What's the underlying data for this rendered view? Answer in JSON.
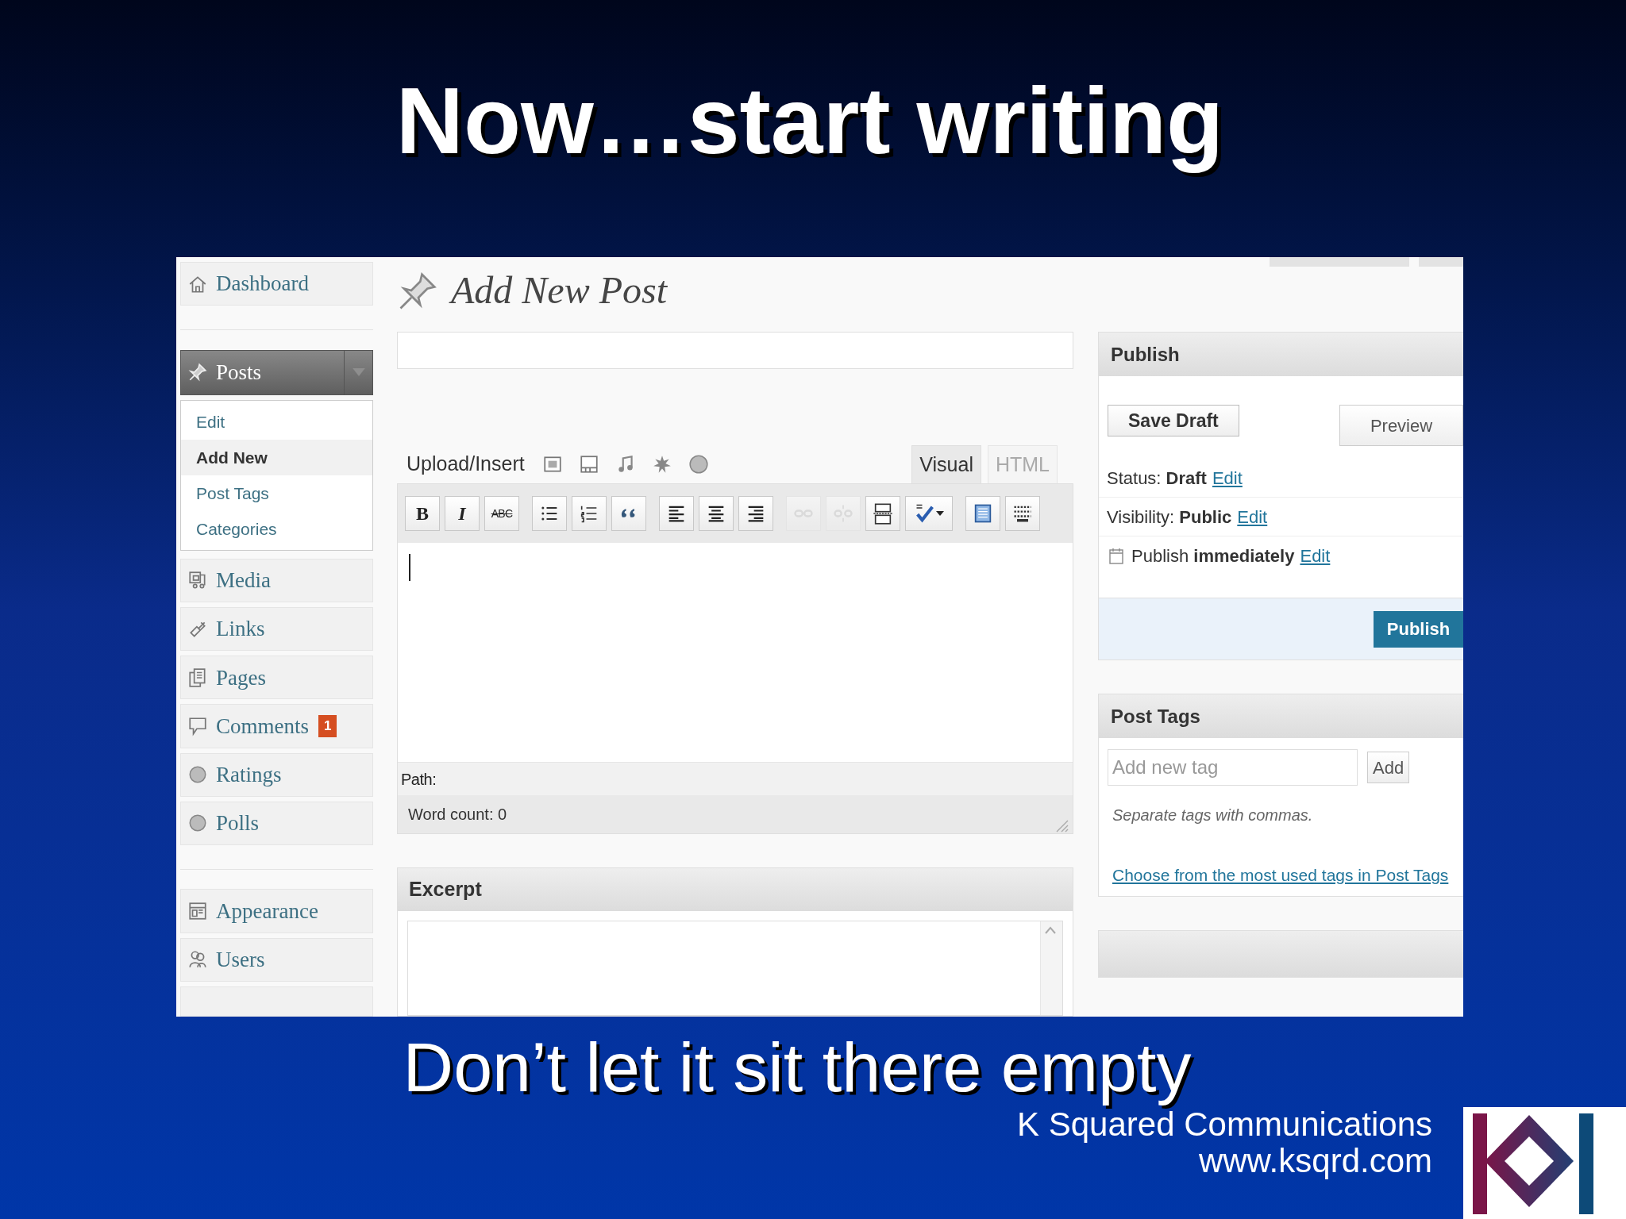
{
  "slide": {
    "title": "Now…start writing",
    "caption": "Don’t let it sit there empty",
    "company": "K Squared Communications",
    "website": "www.ksqrd.com"
  },
  "sidebar": {
    "items": [
      {
        "kind": "menu",
        "label": "Dashboard"
      },
      {
        "kind": "separator"
      },
      {
        "kind": "menu",
        "label": "Posts",
        "expanded": true,
        "children": [
          {
            "label": "Edit",
            "selected": false
          },
          {
            "label": "Add New",
            "selected": true
          },
          {
            "label": "Post Tags",
            "selected": false
          },
          {
            "label": "Categories",
            "selected": false
          }
        ]
      },
      {
        "kind": "menu",
        "label": "Media"
      },
      {
        "kind": "menu",
        "label": "Links"
      },
      {
        "kind": "menu",
        "label": "Pages"
      },
      {
        "kind": "menu",
        "label": "Comments",
        "badge": "1"
      },
      {
        "kind": "menu",
        "label": "Ratings"
      },
      {
        "kind": "menu",
        "label": "Polls"
      },
      {
        "kind": "separator"
      },
      {
        "kind": "menu",
        "label": "Appearance"
      },
      {
        "kind": "menu",
        "label": "Users"
      }
    ]
  },
  "editor": {
    "heading": "Add New Post",
    "upload_label": "Upload/Insert",
    "tabs": [
      {
        "label": "Visual",
        "selected": true
      },
      {
        "label": "HTML",
        "selected": false
      }
    ],
    "toolbar": [
      {
        "kind": "text",
        "label": "B",
        "disabled": false
      },
      {
        "kind": "text",
        "label": "I",
        "disabled": false
      },
      {
        "kind": "text",
        "label": "ABC",
        "disabled": false
      },
      {
        "kind": "icon",
        "disabled": false
      },
      {
        "kind": "icon",
        "disabled": false
      },
      {
        "kind": "icon",
        "disabled": false
      },
      {
        "kind": "icon",
        "disabled": false
      },
      {
        "kind": "icon",
        "disabled": false
      },
      {
        "kind": "icon",
        "disabled": false
      },
      {
        "kind": "icon",
        "disabled": true
      },
      {
        "kind": "icon",
        "disabled": true
      },
      {
        "kind": "icon",
        "disabled": false
      },
      {
        "kind": "icon",
        "disabled": false
      },
      {
        "kind": "icon",
        "disabled": false
      },
      {
        "kind": "icon",
        "disabled": false
      }
    ],
    "path_label": "Path:",
    "word_count": "Word count: 0",
    "excerpt_heading": "Excerpt"
  },
  "publish": {
    "heading": "Publish",
    "save_draft": "Save Draft",
    "preview": "Preview",
    "rows": [
      {
        "text": "Status: **Draft**",
        "link": "Edit"
      },
      {
        "text": "Visibility: **Public**",
        "link": "Edit"
      },
      {
        "text": "Publish **immediately**",
        "link": "Edit"
      }
    ],
    "button": "Publish"
  },
  "post_tags": {
    "heading": "Post Tags",
    "placeholder": "Add new tag",
    "add": "Add",
    "hint": "Separate tags with commas.",
    "link": "Choose from the most used tags in Post Tags"
  }
}
